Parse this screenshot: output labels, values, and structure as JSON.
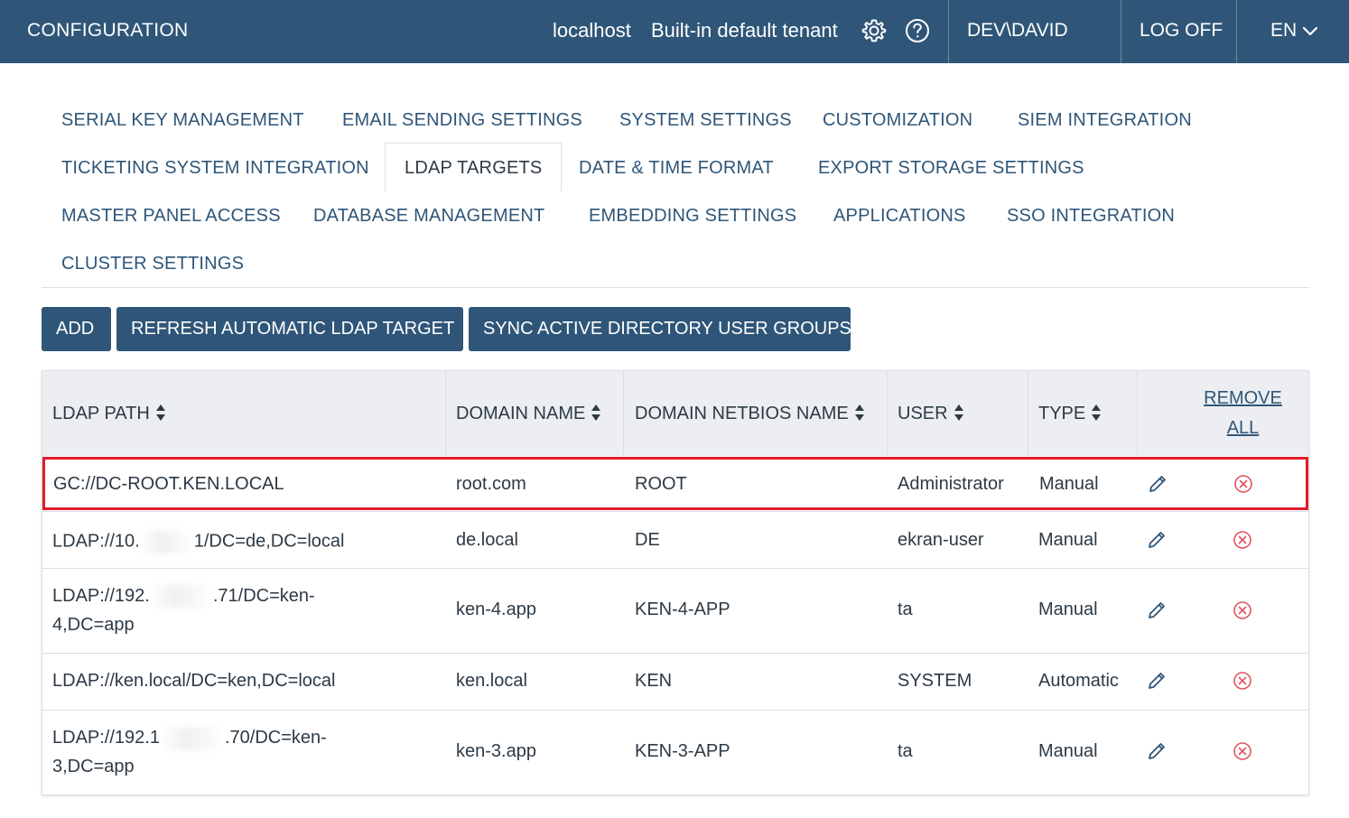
{
  "header": {
    "title": "CONFIGURATION",
    "host": "localhost",
    "tenant": "Built-in default tenant",
    "user": "DEV\\DAVID",
    "logoff": "LOG OFF",
    "language": "EN"
  },
  "tabs": [
    {
      "label": "SERIAL KEY MANAGEMENT"
    },
    {
      "label": "EMAIL SENDING SETTINGS"
    },
    {
      "label": "SYSTEM SETTINGS"
    },
    {
      "label": "CUSTOMIZATION"
    },
    {
      "label": "SIEM INTEGRATION"
    },
    {
      "label": "TICKETING SYSTEM INTEGRATION"
    },
    {
      "label": "LDAP TARGETS",
      "active": true
    },
    {
      "label": "DATE & TIME FORMAT"
    },
    {
      "label": "EXPORT STORAGE SETTINGS"
    },
    {
      "label": "MASTER PANEL ACCESS"
    },
    {
      "label": "DATABASE MANAGEMENT"
    },
    {
      "label": "EMBEDDING SETTINGS"
    },
    {
      "label": "APPLICATIONS"
    },
    {
      "label": "SSO INTEGRATION"
    },
    {
      "label": "CLUSTER SETTINGS"
    }
  ],
  "toolbar": {
    "add": "ADD",
    "refresh": "REFRESH AUTOMATIC LDAP TARGET",
    "sync": "SYNC ACTIVE DIRECTORY USER GROUPS"
  },
  "table": {
    "columns": {
      "ldap_path": "LDAP PATH",
      "domain_name": "DOMAIN NAME",
      "netbios": "DOMAIN NETBIOS NAME",
      "user": "USER",
      "type": "TYPE",
      "remove_all_1": "REMOVE",
      "remove_all_2": "ALL"
    },
    "rows": [
      {
        "path_a": "GC://DC-ROOT.KEN.LOCAL",
        "path_b": "",
        "domain": "root.com",
        "netbios": "ROOT",
        "user": "Administrator",
        "type": "Manual"
      },
      {
        "path_a": "LDAP://10.",
        "path_b": "1/DC=de,DC=local",
        "domain": "de.local",
        "netbios": "DE",
        "user": "ekran-user",
        "type": "Manual"
      },
      {
        "path_a": "LDAP://192.",
        "path_b": ".71/DC=ken-",
        "path_c": "4,DC=app",
        "domain": "ken-4.app",
        "netbios": "KEN-4-APP",
        "user": "ta",
        "type": "Manual"
      },
      {
        "path_a": "LDAP://ken.local/DC=ken,DC=local",
        "path_b": "",
        "domain": "ken.local",
        "netbios": "KEN",
        "user": "SYSTEM",
        "type": "Automatic"
      },
      {
        "path_a": "LDAP://192.1",
        "path_b": ".70/DC=ken-",
        "path_c": "3,DC=app",
        "domain": "ken-3.app",
        "netbios": "KEN-3-APP",
        "user": "ta",
        "type": "Manual"
      }
    ]
  },
  "colors": {
    "topbar": "#2f5678",
    "accent": "#2f5678",
    "highlight": "#e21b2a",
    "remove_icon": "#e0555e"
  },
  "icons": {
    "settings": "gear-icon",
    "help": "help-circle-icon",
    "language": "chevron-down-icon",
    "sort": "sort-icon",
    "edit": "pencil-icon",
    "remove": "remove-circle-icon"
  }
}
